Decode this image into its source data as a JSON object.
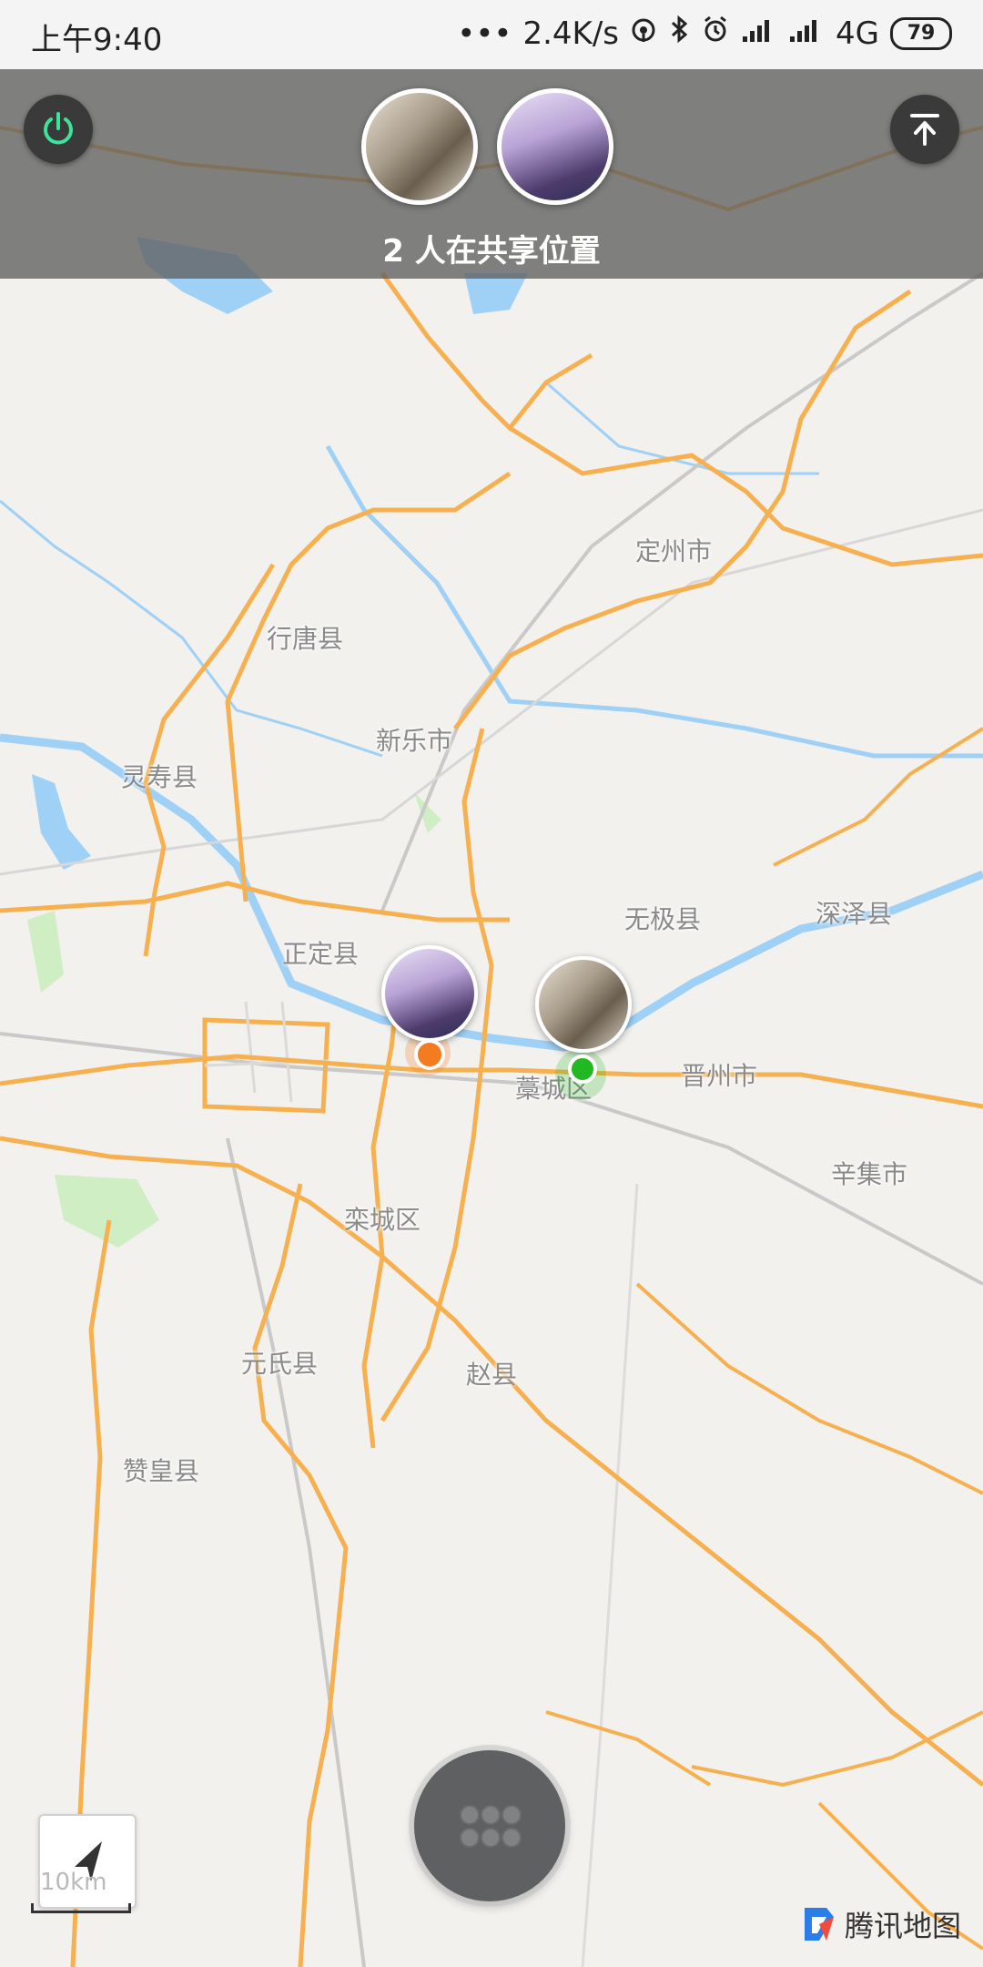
{
  "status_bar": {
    "time": "上午9:40",
    "network_speed": "2.4K/s",
    "network_type": "4G",
    "battery": "79"
  },
  "share_panel": {
    "count_text": "2 人在共享位置"
  },
  "map": {
    "places": [
      "定州市",
      "行唐县",
      "新乐市",
      "灵寿县",
      "正定县",
      "无极县",
      "深泽县",
      "藁城区",
      "晋州市",
      "辛集市",
      "栾城区",
      "元氏县",
      "赵县",
      "赞皇县"
    ],
    "scale": "10km"
  },
  "brand": {
    "name": "腾讯地图"
  },
  "colors": {
    "road": "#f7b04f",
    "river": "#9fd0f5",
    "orange_marker": "#f47b20",
    "green_marker": "#22b822",
    "power_icon": "#3ee39a"
  }
}
